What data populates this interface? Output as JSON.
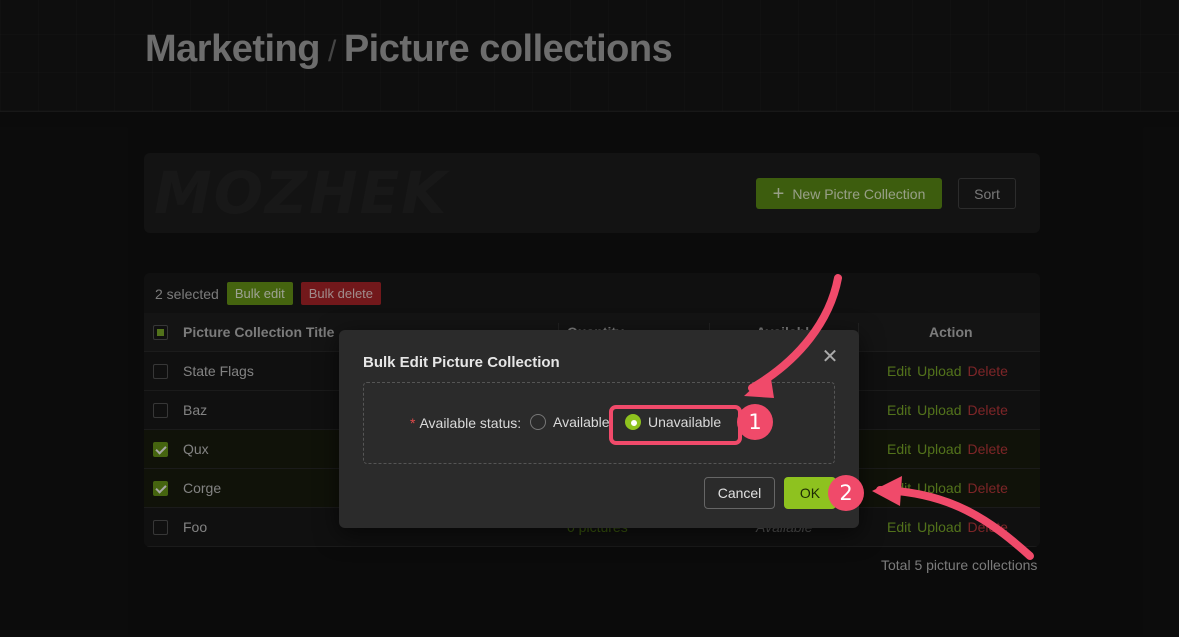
{
  "header": {
    "section": "Marketing",
    "separator": "/",
    "page": "Picture collections"
  },
  "toolbar": {
    "watermark": "MOZHEK",
    "new_label": "New Pictre Collection",
    "sort_label": "Sort"
  },
  "bulk": {
    "selected_text": "2 selected",
    "edit_label": "Bulk edit",
    "delete_label": "Bulk delete"
  },
  "table": {
    "columns": [
      "Picture Collection Title",
      "Quantity",
      "Available",
      "Action"
    ],
    "rows": [
      {
        "title": "State Flags",
        "qty": "",
        "available": "",
        "checked": false
      },
      {
        "title": "Baz",
        "qty": "",
        "available": "",
        "checked": false
      },
      {
        "title": "Qux",
        "qty": "",
        "available": "",
        "checked": true
      },
      {
        "title": "Corge",
        "qty": "",
        "available": "",
        "checked": true
      },
      {
        "title": "Foo",
        "qty": "0 pictures",
        "available": "Available",
        "checked": false
      }
    ],
    "actions": {
      "edit": "Edit",
      "upload": "Upload",
      "delete": "Delete"
    },
    "total": "Total 5 picture collections"
  },
  "modal": {
    "title": "Bulk Edit Picture Collection",
    "close": "✕",
    "field_required": "*",
    "field_label": "Available status:",
    "options": [
      "Available",
      "Unavailable"
    ],
    "selected_option": "Unavailable",
    "cancel_label": "Cancel",
    "ok_label": "OK"
  },
  "annotations": {
    "step1": "1",
    "step2": "2",
    "color": "#f04a6a"
  },
  "colors": {
    "accent": "#8ec21f",
    "primary_button": "#5f8f16",
    "danger": "#c0393d"
  }
}
